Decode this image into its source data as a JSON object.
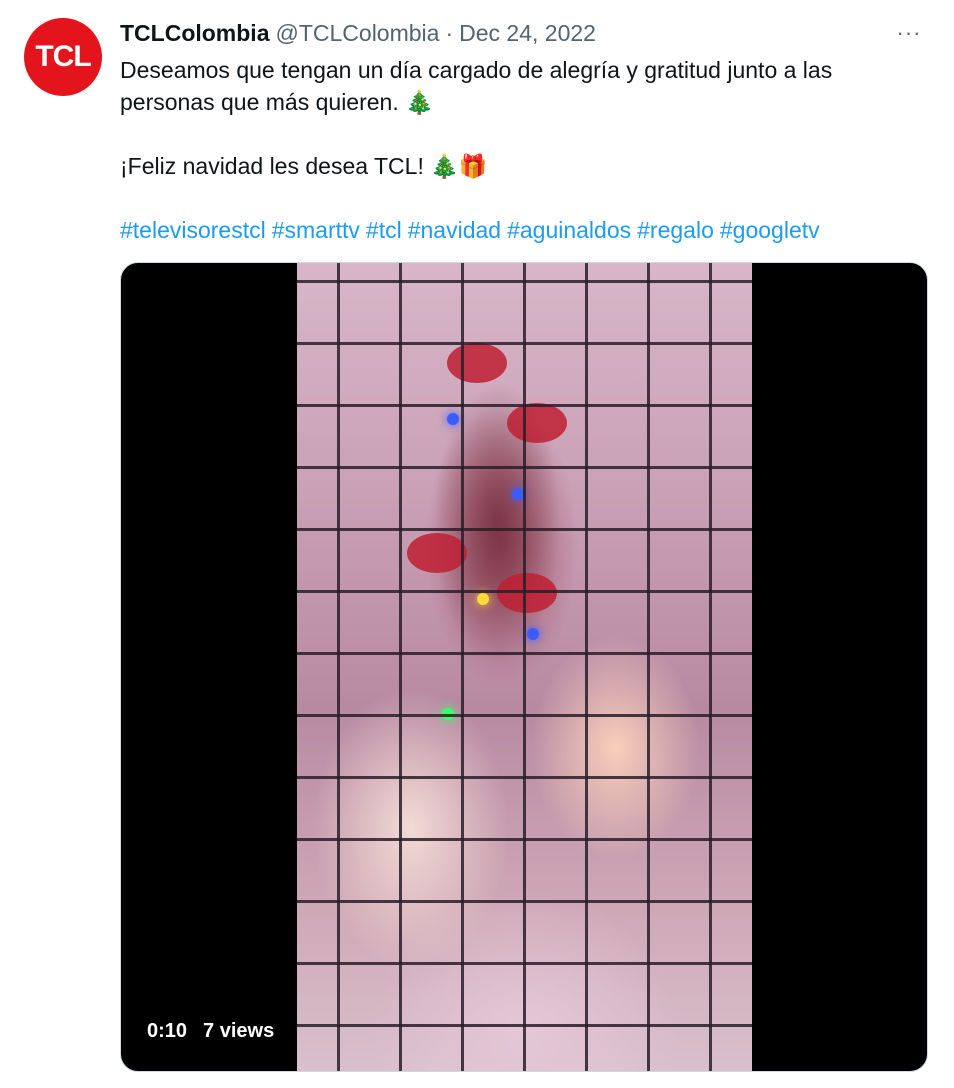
{
  "author": {
    "avatar_text": "TCL",
    "display_name": "TCLColombia",
    "handle": "@TCLColombia",
    "separator": "·",
    "date": "Dec 24, 2022"
  },
  "menu": {
    "more_icon": "···"
  },
  "tweet": {
    "line1": "Deseamos que tengan un día cargado de alegría y gratitud junto a las personas que más quieren. 🎄",
    "line2": "¡Feliz navidad les desea TCL! 🎄🎁",
    "hashtags": [
      "#televisorestcl",
      "#smarttv",
      "#tcl",
      "#navidad",
      "#aguinaldos",
      "#regalo",
      "#googletv"
    ]
  },
  "video": {
    "duration": "0:10",
    "views": "7 views"
  },
  "colors": {
    "brand": "#e3141b",
    "link": "#1d9bf0",
    "muted": "#536471"
  }
}
